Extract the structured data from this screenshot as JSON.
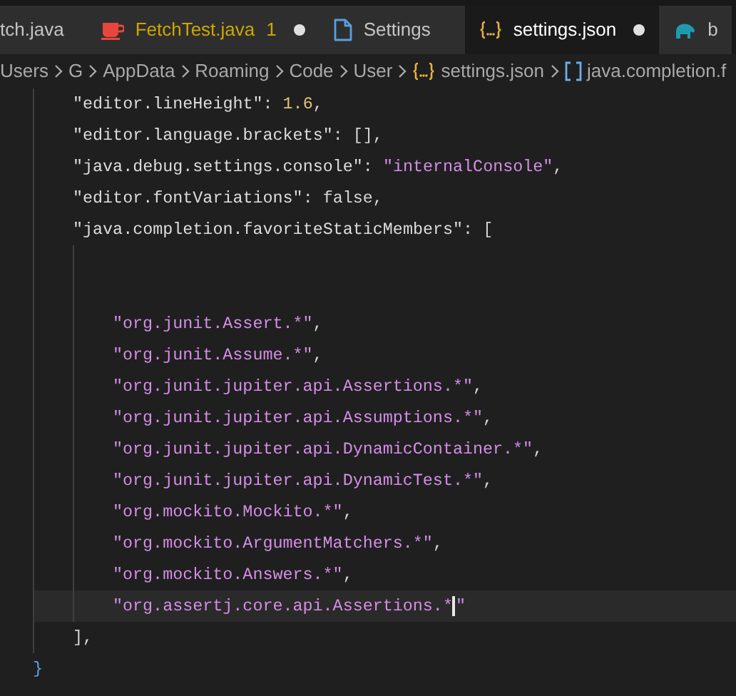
{
  "tabs": [
    {
      "label": "tch.java",
      "selected": false,
      "dirty": false
    },
    {
      "label": "FetchTest.java",
      "kind": "java",
      "selected": false,
      "dirty": true,
      "problems": "1"
    },
    {
      "label": "Settings",
      "kind": "file",
      "selected": false,
      "dirty": false
    },
    {
      "label": "settings.json",
      "kind": "json",
      "selected": true,
      "dirty": true
    },
    {
      "label": "b",
      "kind": "gradle",
      "selected": false,
      "dirty": false
    }
  ],
  "breadcrumbs": [
    {
      "label": "Users"
    },
    {
      "label": "G"
    },
    {
      "label": "AppData"
    },
    {
      "label": "Roaming"
    },
    {
      "label": "Code"
    },
    {
      "label": "User"
    },
    {
      "label": "settings.json",
      "kind": "json"
    },
    {
      "label": "java.completion.f",
      "kind": "array"
    }
  ],
  "editor": {
    "children": [
      {
        "kind": "code",
        "current": false,
        "tokens": [
          {
            "text": "\"editor.lineHeight\"",
            "kind": "key"
          },
          {
            "text": ": ",
            "kind": "punct"
          },
          {
            "text": "1.6",
            "kind": "number"
          },
          {
            "text": ",",
            "kind": "punct"
          }
        ]
      },
      {
        "kind": "code",
        "current": false,
        "tokens": [
          {
            "text": "\"editor.language.brackets\"",
            "kind": "key"
          },
          {
            "text": ": [],",
            "kind": "punct"
          }
        ]
      },
      {
        "kind": "code",
        "current": false,
        "tokens": [
          {
            "text": "\"java.debug.settings.console\"",
            "kind": "key"
          },
          {
            "text": ": ",
            "kind": "punct"
          },
          {
            "text": "\"internalConsole\"",
            "kind": "string"
          },
          {
            "text": ",",
            "kind": "punct"
          }
        ]
      },
      {
        "kind": "code",
        "current": false,
        "tokens": [
          {
            "text": "\"editor.fontVariations\"",
            "kind": "key"
          },
          {
            "text": ": false,",
            "kind": "punct"
          }
        ]
      },
      {
        "kind": "code",
        "current": false,
        "tokens": [
          {
            "text": "\"java.completion.favoriteStaticMembers\"",
            "kind": "key"
          },
          {
            "text": ": [",
            "kind": "punct"
          }
        ],
        "children": [
          {
            "kind": "blank"
          },
          {
            "kind": "blank"
          },
          {
            "kind": "code",
            "current": false,
            "tokens": [
              {
                "text": "\"org.junit.Assert.*\"",
                "kind": "string"
              },
              {
                "text": ",",
                "kind": "punct"
              }
            ]
          },
          {
            "kind": "code",
            "current": false,
            "tokens": [
              {
                "text": "\"org.junit.Assume.*\"",
                "kind": "string"
              },
              {
                "text": ",",
                "kind": "punct"
              }
            ]
          },
          {
            "kind": "code",
            "current": false,
            "tokens": [
              {
                "text": "\"org.junit.jupiter.api.Assertions.*\"",
                "kind": "string"
              },
              {
                "text": ",",
                "kind": "punct"
              }
            ]
          },
          {
            "kind": "code",
            "current": false,
            "tokens": [
              {
                "text": "\"org.junit.jupiter.api.Assumptions.*\"",
                "kind": "string"
              },
              {
                "text": ",",
                "kind": "punct"
              }
            ]
          },
          {
            "kind": "code",
            "current": false,
            "tokens": [
              {
                "text": "\"org.junit.jupiter.api.DynamicContainer.*\"",
                "kind": "string"
              },
              {
                "text": ",",
                "kind": "punct"
              }
            ]
          },
          {
            "kind": "code",
            "current": false,
            "tokens": [
              {
                "text": "\"org.junit.jupiter.api.DynamicTest.*\"",
                "kind": "string"
              },
              {
                "text": ",",
                "kind": "punct"
              }
            ]
          },
          {
            "kind": "code",
            "current": false,
            "tokens": [
              {
                "text": "\"org.mockito.Mockito.*\"",
                "kind": "string"
              },
              {
                "text": ",",
                "kind": "punct"
              }
            ]
          },
          {
            "kind": "code",
            "current": false,
            "tokens": [
              {
                "text": "\"org.mockito.ArgumentMatchers.*\"",
                "kind": "string"
              },
              {
                "text": ",",
                "kind": "punct"
              }
            ]
          },
          {
            "kind": "code",
            "current": false,
            "tokens": [
              {
                "text": "\"org.mockito.Answers.*\"",
                "kind": "string"
              },
              {
                "text": ",",
                "kind": "punct"
              }
            ]
          },
          {
            "kind": "code",
            "current": true,
            "tokens": [
              {
                "text": "\"org.assertj.core.api.Assertions.*",
                "kind": "string"
              },
              {
                "text": "\"",
                "kind": "string"
              }
            ]
          }
        ],
        "close": [
          {
            "text": "],",
            "kind": "punct"
          }
        ]
      }
    ],
    "close": [
      {
        "text": "}",
        "kind": "bracket"
      }
    ]
  }
}
